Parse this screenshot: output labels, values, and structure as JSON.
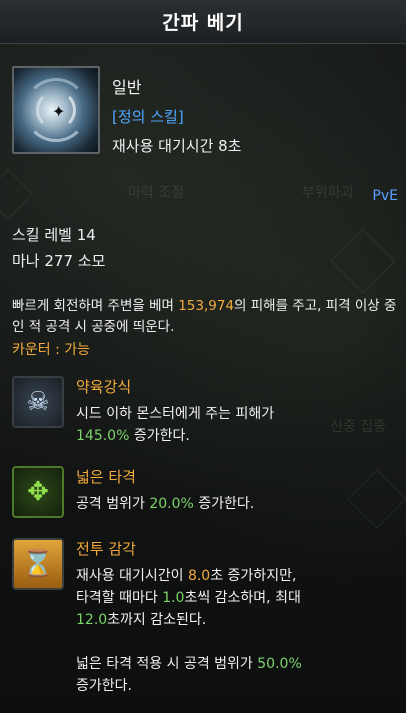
{
  "header": {
    "title": "간파 베기"
  },
  "skill": {
    "grade": "일반",
    "type": "[정의 스킬]",
    "cooldown": "재사용 대기시간 8초",
    "icon": "blade-swirl-icon"
  },
  "background": {
    "ghost_1": "마력 조절",
    "ghost_2": "부위파괴",
    "ghost_3": "신중 집중"
  },
  "pve_label": "PvE",
  "stats": {
    "level": "스킬 레벨 14",
    "mana": "마나 277 소모"
  },
  "description": {
    "part1": "빠르게 회전하며 주변을 베며 ",
    "damage": "153,974",
    "part2": "의 피해를 주고, 피격 이상 중인 적 공격 시 공중에 띄운다.",
    "counter": "카운터 : 가능"
  },
  "tripods": [
    {
      "icon": "skull-icon",
      "name": "약육강식",
      "line1": "시드 이하 몬스터에게 주는 피해가",
      "value": "145.0%",
      "after": " 증가한다."
    },
    {
      "icon": "expand-arrows-icon",
      "name": "넓은 타격",
      "before": "공격 범위가 ",
      "value": "20.0%",
      "after": " 증가한다."
    },
    {
      "icon": "hourglass-icon",
      "name": "전투 감각",
      "l1_before": "재사용 대기시간이 ",
      "l1_value": "8.0",
      "l1_after": "초 증가하지만,",
      "l2_before": "타격할 때마다 ",
      "l2_value": "1.0",
      "l2_after": "초씩 감소하며, 최대",
      "l3_value": "12.0",
      "l3_after": "초까지 감소된다.",
      "l4_before": "넓은 타격 적용 시 공격 범위가 ",
      "l4_value": "50.0%",
      "l5": "증가한다."
    }
  ],
  "colors": {
    "accent_orange": "#f3a93c",
    "accent_green": "#7bd36a",
    "accent_blue": "#4fa8ff"
  }
}
